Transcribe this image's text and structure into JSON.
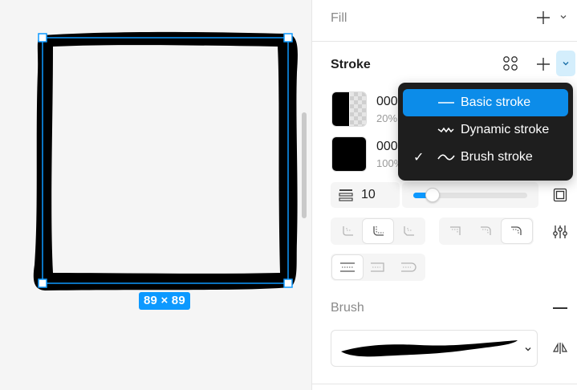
{
  "canvas": {
    "dimension_label": "89 × 89"
  },
  "panel": {
    "fill": {
      "title": "Fill",
      "add_icon": "plus-icon",
      "expand_icon": "chevron-down-icon"
    },
    "stroke": {
      "title": "Stroke",
      "styles_icon": "four-dots-icon",
      "add_icon": "plus-icon",
      "dropdown_icon": "chevron-down-icon",
      "paints": [
        {
          "hex": "000",
          "opacity": "20%",
          "swatch": "half-transparent"
        },
        {
          "hex": "000",
          "opacity": "100%",
          "swatch": "solid-black"
        }
      ],
      "weight": "10",
      "weight_icon": "stroke-weight-icon",
      "slider_fraction": 0.17,
      "accent_color": "#0d99ff",
      "position_icon": "stroke-position-icon",
      "join_icons": [
        "miter-join-icon",
        "round-join-icon",
        "bevel-join-icon"
      ],
      "cap_icons": [
        "cap-none-icon",
        "cap-square-icon",
        "cap-round-icon"
      ],
      "end_icons": [
        "end-butt-icon",
        "end-square-icon",
        "end-round-icon"
      ],
      "settings_icon": "adjust-sliders-icon"
    },
    "brush": {
      "title": "Brush",
      "remove_icon": "minus-icon",
      "flip_icon": "flip-horizontal-icon"
    }
  },
  "stroke_menu": {
    "items": [
      {
        "label": "Basic stroke",
        "icon": "straight-line-icon",
        "highlighted": true,
        "checked": false
      },
      {
        "label": "Dynamic stroke",
        "icon": "wavy-line-icon",
        "highlighted": false,
        "checked": false
      },
      {
        "label": "Brush stroke",
        "icon": "brush-wave-icon",
        "highlighted": false,
        "checked": true
      }
    ],
    "check_glyph": "✓",
    "highlight_color": "#0c8ce9"
  }
}
